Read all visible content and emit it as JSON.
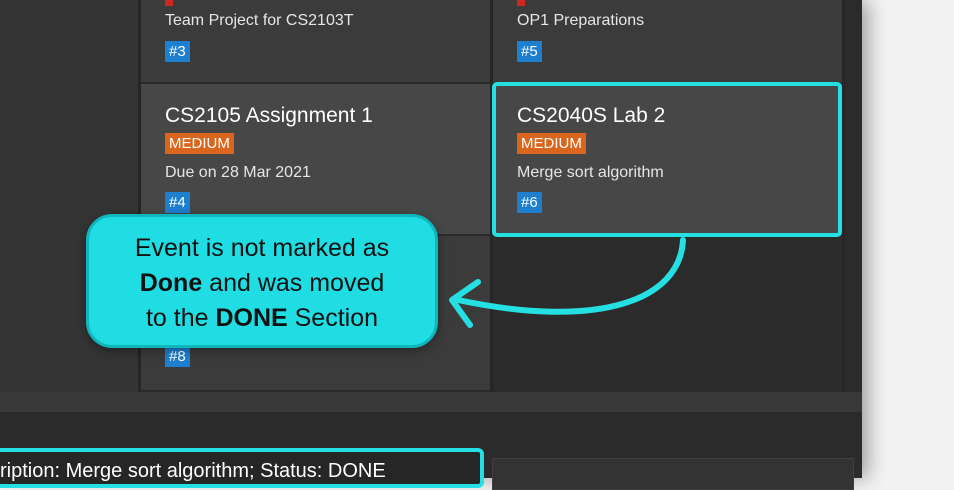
{
  "columns": {
    "top_left_card": {
      "description": "Team Project for CS2103T",
      "id": "#3"
    },
    "top_right_card": {
      "description": "OP1 Preparations",
      "id": "#5"
    },
    "card_4": {
      "title": "CS2105 Assignment 1",
      "priority": "MEDIUM",
      "description": "Due on 28 Mar 2021",
      "id": "#4"
    },
    "card_6": {
      "title": "CS2040S Lab 2",
      "priority": "MEDIUM",
      "description": "Merge sort algorithm",
      "id": "#6"
    },
    "card_8": {
      "id": "#8"
    }
  },
  "callout": {
    "line1": "Event is not marked as",
    "line2_bold": "Done",
    "line2_rest": " and was moved",
    "line3_pre": "to the ",
    "line3_bold": "DONE",
    "line3_post": " Section"
  },
  "result": {
    "text": "ription: Merge sort algorithm; Status: DONE"
  },
  "colors": {
    "accent": "#25e0e3",
    "priority_medium": "#d9661c",
    "priority_high": "#cc2a1e",
    "id_badge": "#1e7fcf"
  }
}
